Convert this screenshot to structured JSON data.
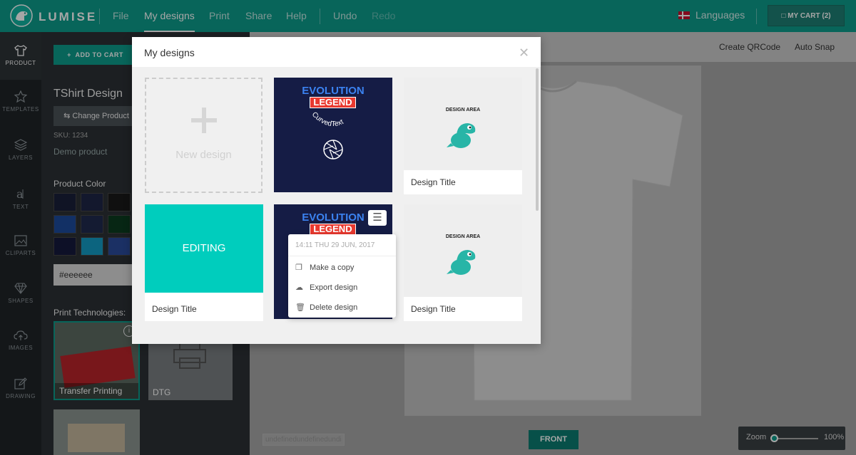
{
  "app": {
    "logo_text": "LUMISE"
  },
  "nav": {
    "file": "File",
    "my_designs": "My designs",
    "print": "Print",
    "share": "Share",
    "help": "Help",
    "undo": "Undo",
    "redo": "Redo",
    "languages": "Languages",
    "cart": "MY CART (2)"
  },
  "sidebar": {
    "items": [
      {
        "label": "PRODUCT",
        "icon": "shirt-icon"
      },
      {
        "label": "TEMPLATES",
        "icon": "star-icon"
      },
      {
        "label": "LAYERS",
        "icon": "layers-icon"
      },
      {
        "label": "TEXT",
        "icon": "text-icon"
      },
      {
        "label": "CLIPARTS",
        "icon": "image-icon"
      },
      {
        "label": "SHAPES",
        "icon": "diamond-icon"
      },
      {
        "label": "IMAGES",
        "icon": "cloud-upload-icon"
      },
      {
        "label": "DRAWING",
        "icon": "pencil-icon"
      }
    ]
  },
  "product_panel": {
    "add_to_cart": "ADD TO CART",
    "title": "TShirt Design",
    "change_product": "Change Product",
    "sku": "SKU: 1234",
    "description": "Demo product",
    "color_label": "Product Color",
    "color_value": "#eeeeee",
    "tech_label": "Print Technologies:",
    "techs": [
      "Transfer Printing",
      "DTG"
    ]
  },
  "colors": {
    "accent": "#0d9b8a",
    "swatches": [
      "#1a1f3a",
      "#1e2545",
      "#1a1a1a",
      "#1c4a9c",
      "#1f2a4d",
      "#0c3b1f",
      "#141a3d",
      "#139ac4",
      "#2a4b9a"
    ]
  },
  "workspace": {
    "create_qrcode": "Create QRCode",
    "auto_snap": "Auto Snap",
    "front": "FRONT",
    "undefined_text": "undefinedundefinedundi",
    "zoom_label": "Zoom",
    "zoom_value": "100%",
    "zoom_level": 1.0
  },
  "modal": {
    "title": "My designs",
    "new_design": "New design",
    "editing": "EDITING",
    "cards": [
      {
        "label": "Design Title",
        "area_text": "DESIGN AREA"
      },
      {
        "label": "Design Title"
      },
      {
        "label": "Design Title",
        "area_text": "DESIGN AREA"
      }
    ],
    "artwork": {
      "evolution": "EVOLUTION",
      "legend": "LEGEND",
      "curved": "CurvedText"
    }
  },
  "context_menu": {
    "date": "14:11 THU 29 JUN, 2017",
    "items": [
      {
        "label": "Make a copy",
        "icon": "copy-icon"
      },
      {
        "label": "Export design",
        "icon": "download-icon"
      },
      {
        "label": "Delete design",
        "icon": "trash-icon"
      }
    ]
  }
}
